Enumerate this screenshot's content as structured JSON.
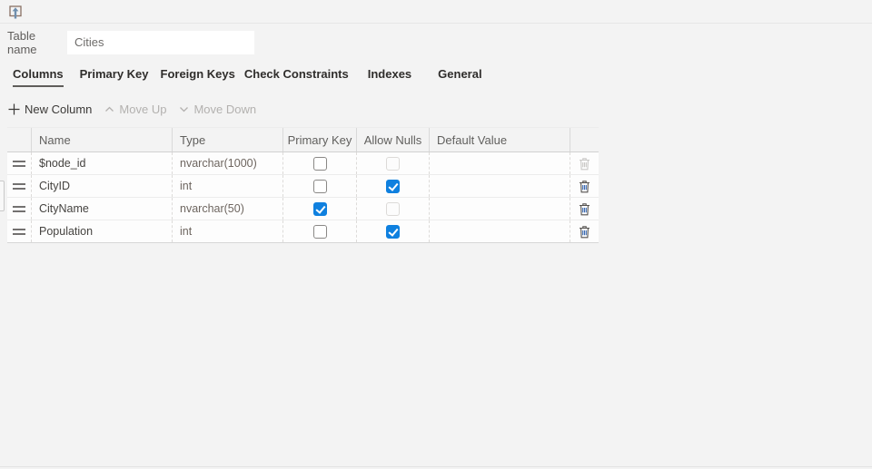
{
  "topbar": {
    "publish_icon": "publish-changes-icon"
  },
  "form": {
    "table_name_label": "Table name",
    "table_name_value": "Cities"
  },
  "tabs": [
    {
      "label": "Columns",
      "active": true
    },
    {
      "label": "Primary Key",
      "active": false
    },
    {
      "label": "Foreign Keys",
      "active": false
    },
    {
      "label": "Check Constraints",
      "active": false
    },
    {
      "label": "Indexes",
      "active": false
    },
    {
      "label": "General",
      "active": false
    }
  ],
  "grid_toolbar": {
    "new_column": "New Column",
    "new_column_enabled": true,
    "move_up": "Move Up",
    "move_up_enabled": false,
    "move_down": "Move Down",
    "move_down_enabled": false
  },
  "grid": {
    "headers": {
      "name": "Name",
      "type": "Type",
      "primary_key": "Primary Key",
      "allow_nulls": "Allow Nulls",
      "default_value": "Default Value"
    },
    "rows": [
      {
        "name": "$node_id",
        "type": "nvarchar(1000)",
        "primary_key": {
          "checked": false,
          "enabled": true
        },
        "allow_nulls": {
          "checked": false,
          "enabled": false
        },
        "default_value": "",
        "delete_enabled": false
      },
      {
        "name": "CityID",
        "type": "int",
        "primary_key": {
          "checked": false,
          "enabled": true
        },
        "allow_nulls": {
          "checked": true,
          "enabled": true
        },
        "default_value": "",
        "delete_enabled": true
      },
      {
        "name": "CityName",
        "type": "nvarchar(50)",
        "primary_key": {
          "checked": true,
          "enabled": true
        },
        "allow_nulls": {
          "checked": false,
          "enabled": false
        },
        "default_value": "",
        "delete_enabled": true
      },
      {
        "name": "Population",
        "type": "int",
        "primary_key": {
          "checked": false,
          "enabled": true
        },
        "allow_nulls": {
          "checked": true,
          "enabled": true
        },
        "default_value": "",
        "delete_enabled": true
      }
    ]
  },
  "colors": {
    "background": "#f3f3f3",
    "row_background": "#fdfdfd",
    "checkbox_checked": "#0f80df",
    "tab_underline": "#5f5d5b",
    "disabled_text": "#b3b1af"
  }
}
